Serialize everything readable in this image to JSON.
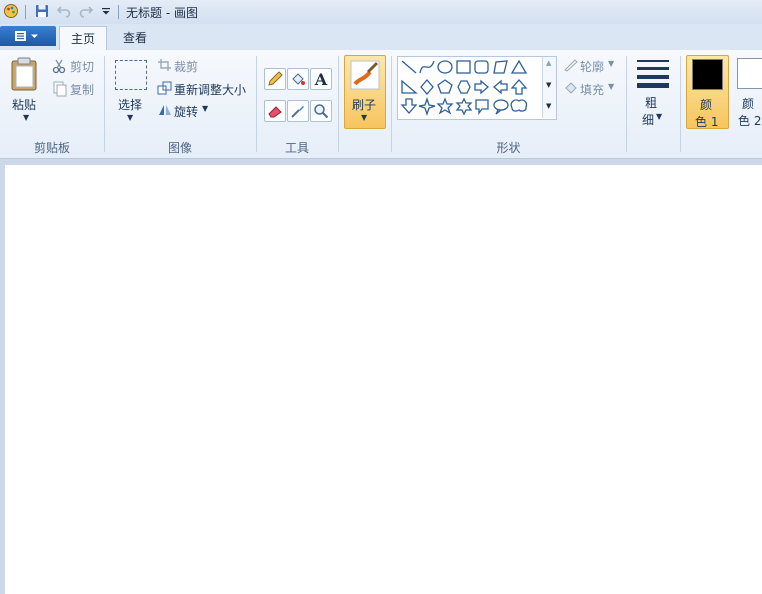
{
  "titlebar": {
    "title": "无标题 - 画图"
  },
  "tabs": {
    "home": "主页",
    "view": "查看"
  },
  "clipboard": {
    "paste": "粘贴",
    "cut": "剪切",
    "copy": "复制",
    "group": "剪贴板"
  },
  "image": {
    "select": "选择",
    "crop": "裁剪",
    "resize": "重新调整大小",
    "rotate": "旋转",
    "group": "图像"
  },
  "tools": {
    "text_glyph": "A",
    "group": "工具"
  },
  "brush": {
    "label": "刷子"
  },
  "shapes": {
    "outline": "轮廓",
    "fill": "填充",
    "group": "形状"
  },
  "size": {
    "label_top": "粗",
    "label_bottom": "细"
  },
  "colors": {
    "color1_top": "颜",
    "color1_bottom": "色 1",
    "color2_top": "颜",
    "color2_bottom": "色 2",
    "color1_value": "#000000",
    "color2_value": "#ffffff"
  },
  "theme": {
    "accent": "#f7c55f",
    "ribbon_text": "#1e395b",
    "canvas": "#ffffff"
  }
}
